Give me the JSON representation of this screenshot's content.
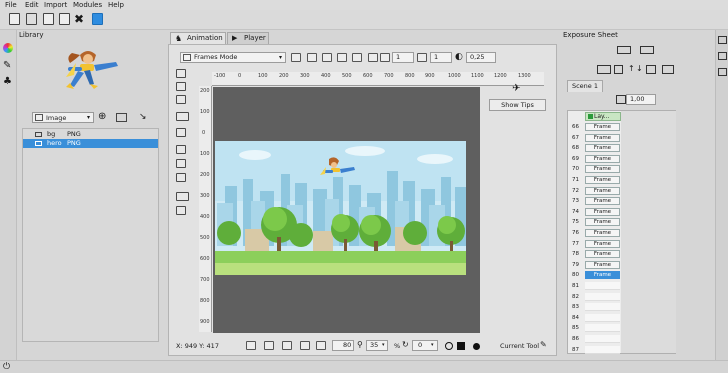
{
  "menu": [
    "File",
    "Edit",
    "Import",
    "Modules",
    "Help"
  ],
  "library": {
    "title": "Library",
    "type_select": "Image",
    "items": [
      {
        "name": "bg",
        "type": "PNG",
        "selected": false
      },
      {
        "name": "hero",
        "type": "PNG",
        "selected": true
      }
    ]
  },
  "tabs": [
    {
      "label": "Animation",
      "active": true
    },
    {
      "label": "Player",
      "active": false
    }
  ],
  "animation": {
    "mode": "Frames Mode",
    "spin1": "1",
    "spin2": "1",
    "opacity": "0,25",
    "show_tips": "Show Tips",
    "ruler_top": [
      "-100",
      "0",
      "100",
      "200",
      "300",
      "400",
      "500",
      "600",
      "700",
      "800",
      "900",
      "1000",
      "1100",
      "1200",
      "1300"
    ],
    "ruler_left": [
      "200",
      "100",
      "0",
      "100",
      "200",
      "300",
      "400",
      "500",
      "600",
      "700",
      "800",
      "900"
    ]
  },
  "status": {
    "coords": "X: 949 Y: 417",
    "zoom": "80",
    "rotation": "35",
    "percent": "%",
    "angle": "0",
    "current_tool": "Current Tool"
  },
  "exposure": {
    "title": "Exposure Sheet",
    "scene": "Scene 1",
    "value": "1,00",
    "layer": "Lay...",
    "rows": [
      "66",
      "67",
      "68",
      "69",
      "70",
      "71",
      "72",
      "73",
      "74",
      "75",
      "76",
      "77",
      "78",
      "79",
      "80",
      "81",
      "82",
      "83",
      "84",
      "85",
      "86",
      "87"
    ],
    "frames": [
      "Frame",
      "Frame",
      "Frame",
      "Frame",
      "Frame",
      "Frame",
      "Frame",
      "Frame",
      "Frame",
      "Frame",
      "Frame",
      "Frame",
      "Frame",
      "Frame",
      "Frame"
    ],
    "selected_row": "80"
  },
  "colors": {
    "accent": "#3a8fd9",
    "canvas": "#5f5f5f"
  }
}
